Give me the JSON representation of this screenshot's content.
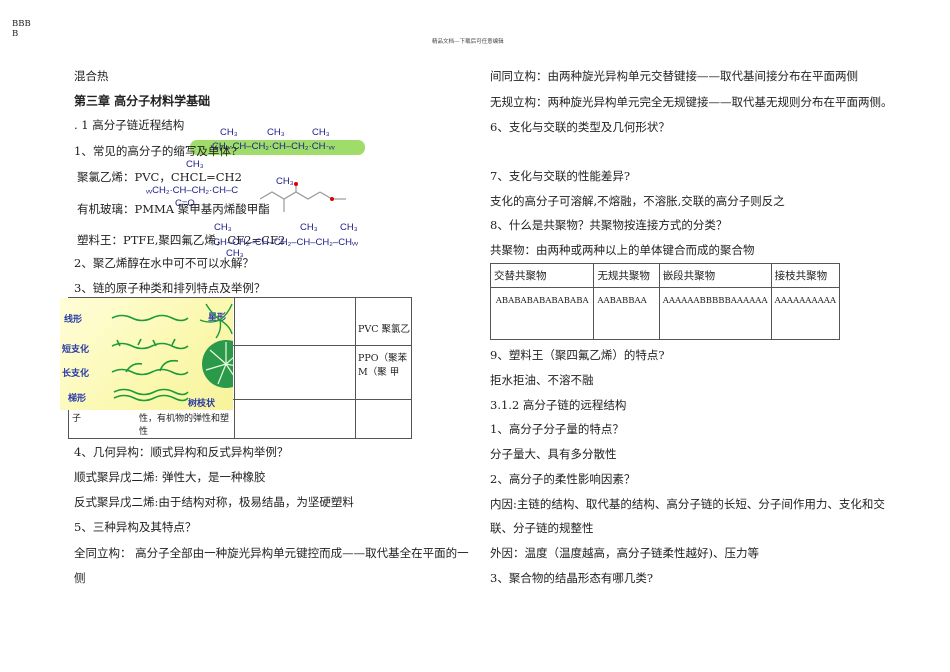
{
  "header": {
    "corner": "BBB\nB",
    "caption": "精品文档---下载后可任意编辑"
  },
  "left": {
    "l1": "混合热",
    "l2": "第三章  高分子材料学基础",
    "l3": ". 1 高分子链近程结构",
    "l4": "1、常见的高分子的缩写及单体?",
    "l5": "聚氯乙烯：PVC，CHCL=CH2",
    "l6": "有机玻璃：PMMA 聚甲基丙烯酸甲酯",
    "l7": "塑料王：PTFE,聚四氟乙烯，CF2=CF2",
    "l8": "2、聚乙烯醇在水中可不可以水解？",
    "l9": "3、链的原子种类和排列特点及举例？",
    "table_frag": {
      "r1": "PVC 聚氯乙",
      "r2a": "PPO（聚苯",
      "r2b": "M（聚 甲",
      "r3a": "子",
      "r3b": "性，有机物的弹性和塑",
      "r3c": "性"
    },
    "l10": "4、几何异构：顺式异构和反式异构举例？",
    "l11": "顺式聚异戊二烯: 弹性大，是一种橡胶",
    "l12": "反式聚异戊二烯:由于结构对称，极易结晶，为坚硬塑料",
    "l13": "5、三种异构及其特点？",
    "l14": "全同立构：   高分子全部由一种旋光异构单元键控而成——取代基全在平面的一",
    "l15": "侧"
  },
  "chem": {
    "ch3": "CH₃",
    "chain1": "CH₂·CH–CH₂·CH–CH₂·CH·ᵥᵥ",
    "chain2": "ᵥᵥCH₂·CH–CH₂·CH–C",
    "chain3": "CH₂–CH–CH₂·CH–CH₂·CH",
    "chain4": "·CH–CH₂–CH–CH₂–CH–CH₂–CHᵥᵥ",
    "oc": "C=O",
    "och3": "OCH₃"
  },
  "image_labels": {
    "linear": "线形",
    "star": "星形",
    "short": "短支化",
    "long": "长支化",
    "ladder": "梯形",
    "dendritic": "树枝状"
  },
  "right": {
    "r1": "间同立构：由两种旋光异构单元交替键接——取代基间接分布在平面两侧",
    "r2": "无规立构：两种旋光异构单元完全无规键接——取代基无规则分布在平面两侧。",
    "r3": "6、支化与交联的类型及几何形状？",
    "r4": "7、支化与交联的性能差异?",
    "r5": "支化的高分子可溶解,不熔融，不溶胀,交联的高分子则反之",
    "r6": "8、什么是共聚物？共聚物按连接方式的分类？",
    "r7": "共聚物：由两种或两种以上的单体键合而成的聚合物",
    "table": {
      "headers": [
        "交替共聚物",
        "无规共聚物",
        "嵌段共聚物",
        "接枝共聚物"
      ],
      "cells": [
        "ABABABABABABABA",
        "AABABBAA",
        "AAAAAABBBBBAAAAAA",
        "AAAAAAAAAA"
      ]
    },
    "r8": "9、塑料王（聚四氟乙烯）的特点?",
    "r9": "拒水拒油、不溶不融",
    "r10": "3.1.2    高分子链的远程结构",
    "r11": "1、高分子分子量的特点？",
    "r12": "分子量大、具有多分散性",
    "r13": "2、高分子的柔性影响因素？",
    "r14": "内因:主链的结构、取代基的结构、高分子链的长短、分子间作用力、支化和交",
    "r15": "联、分子链的规整性",
    "r16": "外因：温度（温度越高，高分子链柔性越好)、压力等",
    "r17": "3、聚合物的结晶形态有哪几类?"
  }
}
